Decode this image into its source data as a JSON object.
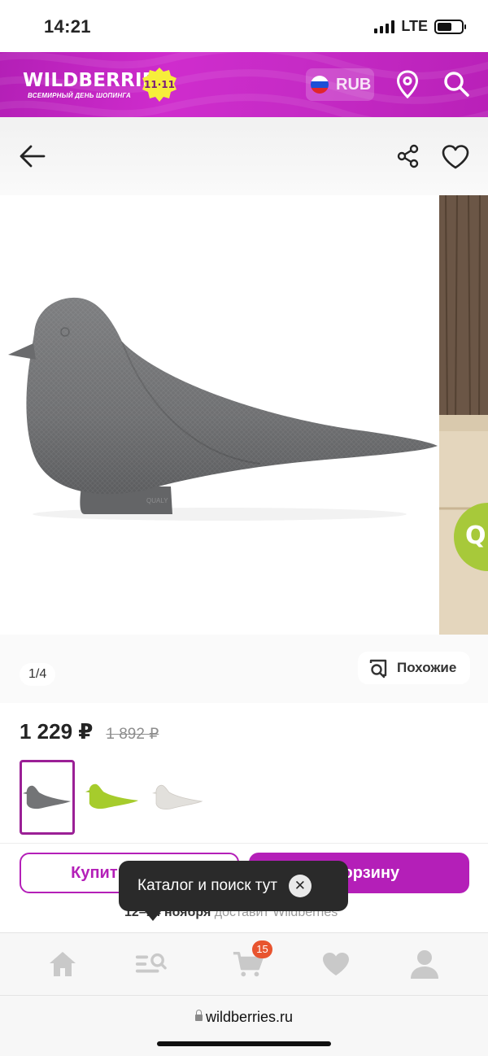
{
  "status_bar": {
    "time": "14:21",
    "network": "LTE"
  },
  "header": {
    "logo": "WILDBERRIES",
    "logo_subtitle": "ВСЕМИРНЫЙ ДЕНЬ ШОПИНГА",
    "promo_badge": "11·11",
    "currency": "RUB",
    "brand_color": "#b41fb8"
  },
  "gallery": {
    "counter": "1/4",
    "similar_button": "Похожие",
    "image_description_icon": "dove-doorstop"
  },
  "product": {
    "price_current": "1 229 ₽",
    "price_old": "1 892 ₽",
    "variants": [
      "grey",
      "lime-green",
      "white"
    ],
    "selected_variant": 0
  },
  "actions": {
    "buy_now": "Купить сейчас",
    "add_to_cart": "В корзину",
    "delivery_date": "12–14 ноября",
    "delivery_text": " доставит Wildberries"
  },
  "tooltip": {
    "text": "Каталог и поиск тут",
    "close_icon": "close-icon"
  },
  "tabbar": {
    "items": [
      "home-icon",
      "catalog-search-icon",
      "cart-icon",
      "favorites-icon",
      "profile-icon"
    ],
    "cart_count": "15"
  },
  "browser": {
    "url": "wildberries.ru"
  }
}
